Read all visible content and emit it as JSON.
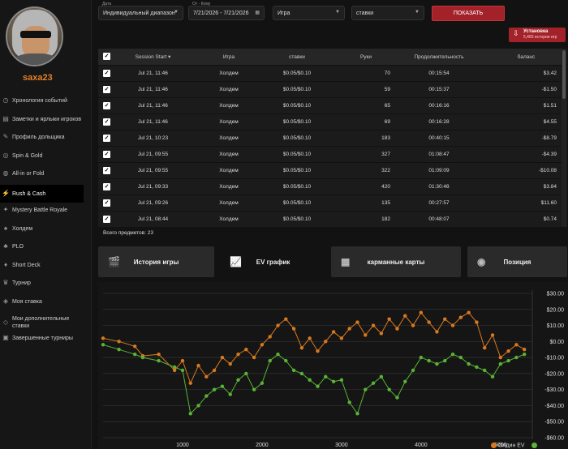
{
  "sidebar": {
    "username": "saxa23",
    "items": [
      {
        "label": "Хронология событий",
        "icon": "clock-icon"
      },
      {
        "label": "Заметки и ярлыки игроков",
        "icon": "notes-icon"
      },
      {
        "label": "Профиль дольщика",
        "icon": "pen-icon"
      },
      {
        "label": "Spin & Gold",
        "icon": "spin-icon"
      },
      {
        "label": "All-in or Fold",
        "icon": "allin-icon"
      },
      {
        "label": "Rush & Cash",
        "icon": "rush-icon"
      },
      {
        "label": "Mystery Battle Royale",
        "icon": "mystery-icon"
      },
      {
        "label": "Холдем",
        "icon": "cards-icon"
      },
      {
        "label": "PLO",
        "icon": "plo-icon"
      },
      {
        "label": "Short Deck",
        "icon": "shortdeck-icon"
      },
      {
        "label": "Турнир",
        "icon": "trophy-icon"
      },
      {
        "label": "Моя ставка",
        "icon": "stake-icon"
      },
      {
        "label": "Мои дополнительные ставки",
        "icon": "extra-stake-icon"
      },
      {
        "label": "Завершенные турниры",
        "icon": "finished-icon"
      }
    ]
  },
  "filters": {
    "date_caption": "Дата",
    "date_value": "Индивидуальный диапазон",
    "range_caption": "От - Кому",
    "range_value": "7/21/2026  - 7/21/2026",
    "game_value": "Игра",
    "stakes_value": "ставки",
    "show_label": "ПОКАЗАТЬ",
    "install_label": "Установка",
    "install_sub": "5,483 истории игр"
  },
  "table": {
    "headers": [
      "Session Start",
      "Игра",
      "ставки",
      "Руки",
      "Продолжительность",
      "баланс"
    ],
    "rows": [
      [
        "Jul 21, 11:46",
        "Холдем",
        "$0.05/$0.10",
        "70",
        "00:15:54",
        "$3.42"
      ],
      [
        "Jul 21, 11:46",
        "Холдем",
        "$0.05/$0.10",
        "59",
        "00:15:37",
        "-$1.50"
      ],
      [
        "Jul 21, 11:46",
        "Холдем",
        "$0.05/$0.10",
        "65",
        "00:16:16",
        "$1.51"
      ],
      [
        "Jul 21, 11:46",
        "Холдем",
        "$0.05/$0.10",
        "69",
        "00:16:28",
        "$4.55"
      ],
      [
        "Jul 21, 10:23",
        "Холдем",
        "$0.05/$0.10",
        "183",
        "00:40:15",
        "-$8.79"
      ],
      [
        "Jul 21, 09:55",
        "Холдем",
        "$0.05/$0.10",
        "327",
        "01:08:47",
        "-$4.39"
      ],
      [
        "Jul 21, 09:55",
        "Холдем",
        "$0.05/$0.10",
        "322",
        "01:09:09",
        "-$10.08"
      ],
      [
        "Jul 21, 09:33",
        "Холдем",
        "$0.05/$0.10",
        "420",
        "01:30:48",
        "$3.84"
      ],
      [
        "Jul 21, 09:26",
        "Холдем",
        "$0.05/$0.10",
        "135",
        "00:27:57",
        "$11.60"
      ],
      [
        "Jul 21, 08:44",
        "Холдем",
        "$0.05/$0.10",
        "182",
        "00:48:07",
        "$0.74"
      ]
    ],
    "total_label": "Всего предметов: 23"
  },
  "tabs": [
    {
      "label": "История игры",
      "icon": "film-icon"
    },
    {
      "label": "EV график",
      "icon": "chart-icon"
    },
    {
      "label": "карманные карты",
      "icon": "grid-icon"
    },
    {
      "label": "Позиция",
      "icon": "position-icon"
    }
  ],
  "chart_data": {
    "type": "line",
    "x_ticks": [
      "1000",
      "2000",
      "3000",
      "4000",
      "5000"
    ],
    "x_range": [
      0,
      5400
    ],
    "y_ticks": [
      "$30.00",
      "$20.00",
      "$10.00",
      "$0.00",
      "-$10.00",
      "-$20.00",
      "-$30.00",
      "-$40.00",
      "-$50.00",
      "-$60.00"
    ],
    "y_range": [
      -60,
      30
    ],
    "series": [
      {
        "name": "Олдин EV",
        "color": "#d9791d",
        "x": [
          0,
          200,
          400,
          500,
          700,
          900,
          1000,
          1100,
          1200,
          1300,
          1400,
          1500,
          1600,
          1700,
          1800,
          1900,
          2000,
          2100,
          2200,
          2300,
          2400,
          2500,
          2600,
          2700,
          2800,
          2900,
          3000,
          3100,
          3200,
          3300,
          3400,
          3500,
          3600,
          3700,
          3800,
          3900,
          4000,
          4100,
          4200,
          4300,
          4400,
          4500,
          4600,
          4700,
          4800,
          4900,
          5000,
          5100,
          5200,
          5300
        ],
        "y": [
          2,
          0,
          -3,
          -9,
          -8,
          -18,
          -12,
          -26,
          -15,
          -22,
          -18,
          -10,
          -14,
          -8,
          -5,
          -10,
          -2,
          3,
          10,
          14,
          8,
          -4,
          2,
          -6,
          0,
          6,
          2,
          8,
          12,
          4,
          10,
          5,
          14,
          8,
          16,
          10,
          18,
          12,
          6,
          14,
          10,
          15,
          18,
          12,
          -4,
          4,
          -10,
          -6,
          -2,
          -5
        ]
      },
      {
        "name": "",
        "color": "#59b336",
        "x": [
          0,
          200,
          400,
          500,
          700,
          900,
          1000,
          1100,
          1200,
          1300,
          1400,
          1500,
          1600,
          1700,
          1800,
          1900,
          2000,
          2100,
          2200,
          2300,
          2400,
          2500,
          2600,
          2700,
          2800,
          2900,
          3000,
          3100,
          3200,
          3300,
          3400,
          3500,
          3600,
          3700,
          3800,
          3900,
          4000,
          4100,
          4200,
          4300,
          4400,
          4500,
          4600,
          4700,
          4800,
          4900,
          5000,
          5100,
          5200,
          5300
        ],
        "y": [
          -2,
          -5,
          -8,
          -10,
          -12,
          -16,
          -18,
          -45,
          -40,
          -34,
          -30,
          -28,
          -33,
          -24,
          -20,
          -30,
          -26,
          -12,
          -8,
          -12,
          -18,
          -20,
          -24,
          -28,
          -22,
          -25,
          -24,
          -38,
          -45,
          -30,
          -26,
          -22,
          -30,
          -35,
          -25,
          -18,
          -10,
          -12,
          -14,
          -12,
          -8,
          -10,
          -14,
          -16,
          -18,
          -22,
          -14,
          -12,
          -10,
          -8
        ]
      }
    ]
  }
}
